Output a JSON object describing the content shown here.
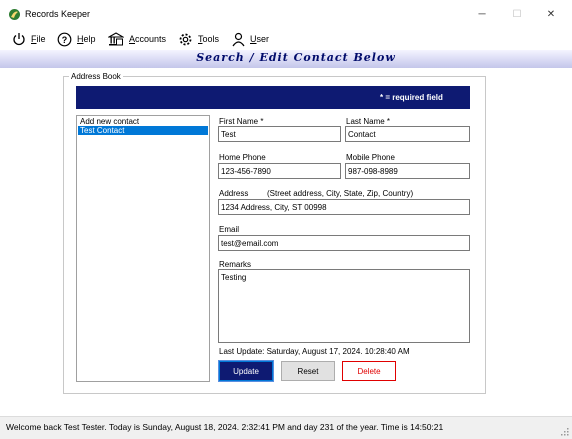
{
  "window": {
    "title": "Records Keeper",
    "minimize": "─",
    "maximize": "☐",
    "close": "✕"
  },
  "menu": [
    {
      "label": "File",
      "icon": "power-icon"
    },
    {
      "label": "Help",
      "icon": "help-icon"
    },
    {
      "label": "Accounts",
      "icon": "bank-icon"
    },
    {
      "label": "Tools",
      "icon": "gear-icon"
    },
    {
      "label": "User",
      "icon": "user-icon"
    }
  ],
  "banner": {
    "title": "Search / Edit Contact Below"
  },
  "address_book": {
    "group_label": "Address Book",
    "required_note": "*  =  required field",
    "list": [
      "Add new contact",
      "Test Contact"
    ],
    "selected_index": 1
  },
  "form": {
    "first_name_label": "First Name *",
    "first_name": "Test",
    "last_name_label": "Last Name *",
    "last_name": "Contact",
    "home_phone_label": "Home Phone",
    "home_phone": "123-456-7890",
    "mobile_phone_label": "Mobile Phone",
    "mobile_phone": "987-098-8989",
    "address_label": "Address",
    "address_hint": "(Street address, City, State, Zip, Country)",
    "address": "1234 Address, City, ST 00998",
    "email_label": "Email",
    "email": "test@email.com",
    "remarks_label": "Remarks",
    "remarks": "Testing",
    "last_update": "Last Update: Saturday, August 17, 2024. 10:28:40 AM"
  },
  "buttons": {
    "update": "Update",
    "reset": "Reset",
    "delete": "Delete"
  },
  "status": {
    "text": "Welcome back Test Tester.   Today is Sunday, August 18, 2024. 2:32:41 PM and day 231 of the year.   Time is 14:50:21"
  },
  "colors": {
    "header_strip": "#0e1a72",
    "banner_text": "#000b6b",
    "selection": "#0078d7",
    "delete_text": "#e00000"
  }
}
